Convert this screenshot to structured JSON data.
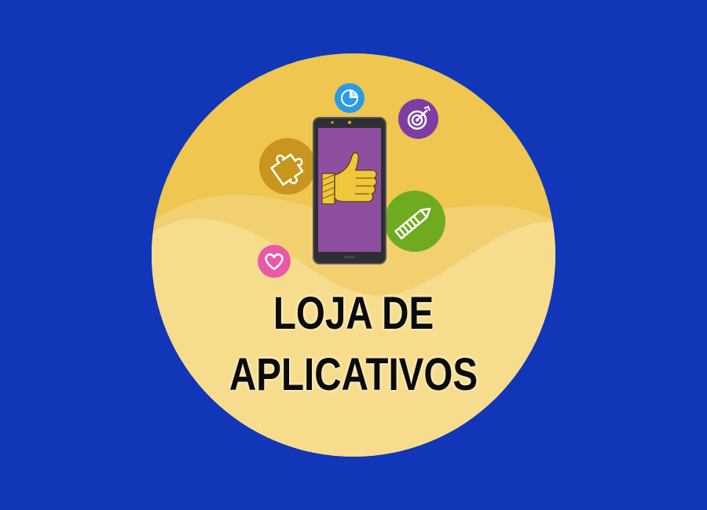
{
  "colors": {
    "background": "#1136b8",
    "badge": "#eec650",
    "badge_light": "#f6dc8c",
    "screen": "#8e4fa0",
    "thumb": "#f0c63a",
    "puzzle_bubble": "#c8961e",
    "pencil_bubble": "#6fab1f",
    "target_bubble": "#7e3da3",
    "chart_bubble": "#2a9be6",
    "heart_bubble": "#e85aa8"
  },
  "title": {
    "line1": "LOJA DE",
    "line2": "APLICATIVOS"
  },
  "icons": {
    "phone": "smartphone-icon",
    "thumb": "thumbs-up-icon",
    "puzzle": "puzzle-icon",
    "pencil": "pencil-icon",
    "target": "target-icon",
    "chart": "pie-chart-icon",
    "heart": "heart-icon"
  }
}
